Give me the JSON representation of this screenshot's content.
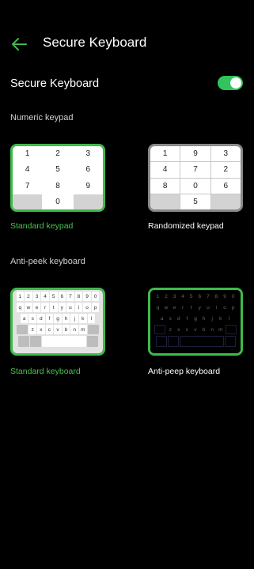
{
  "header": {
    "title": "Secure Keyboard"
  },
  "secure_toggle": {
    "label": "Secure Keyboard",
    "state": "on",
    "color": "#2fc45c"
  },
  "numeric_section": {
    "title": "Numeric keypad"
  },
  "standard_keypad": {
    "caption": "Standard keypad",
    "keys": [
      "1",
      "2",
      "3",
      "4",
      "5",
      "6",
      "7",
      "8",
      "9",
      "",
      "0",
      ""
    ]
  },
  "randomized_keypad": {
    "caption": "Randomized keypad",
    "keys": [
      "1",
      "9",
      "3",
      "4",
      "7",
      "2",
      "8",
      "0",
      "6",
      "",
      "5",
      ""
    ]
  },
  "antipeek_section": {
    "title": "Anti-peek keyboard"
  },
  "standard_keyboard": {
    "caption": "Standard keyboard",
    "rows": [
      [
        "1",
        "2",
        "3",
        "4",
        "5",
        "6",
        "7",
        "8",
        "9",
        "0"
      ],
      [
        "q",
        "w",
        "e",
        "r",
        "t",
        "y",
        "u",
        "i",
        "o",
        "p"
      ],
      [
        "a",
        "s",
        "d",
        "f",
        "g",
        "h",
        "j",
        "k",
        "l"
      ],
      [
        "z",
        "x",
        "c",
        "v",
        "b",
        "n",
        "m"
      ]
    ]
  },
  "antipeep_keyboard": {
    "caption": "Anti-peep keyboard",
    "rows": [
      [
        "1",
        "2",
        "3",
        "4",
        "5",
        "6",
        "7",
        "8",
        "9",
        "0"
      ],
      [
        "q",
        "w",
        "e",
        "r",
        "t",
        "y",
        "u",
        "i",
        "o",
        "p"
      ],
      [
        "a",
        "s",
        "d",
        "f",
        "g",
        "h",
        "j",
        "k",
        "l"
      ],
      [
        "z",
        "x",
        "c",
        "v",
        "b",
        "n",
        "m"
      ]
    ]
  },
  "colors": {
    "accent_green": "#3fba4a",
    "background": "#000000"
  }
}
